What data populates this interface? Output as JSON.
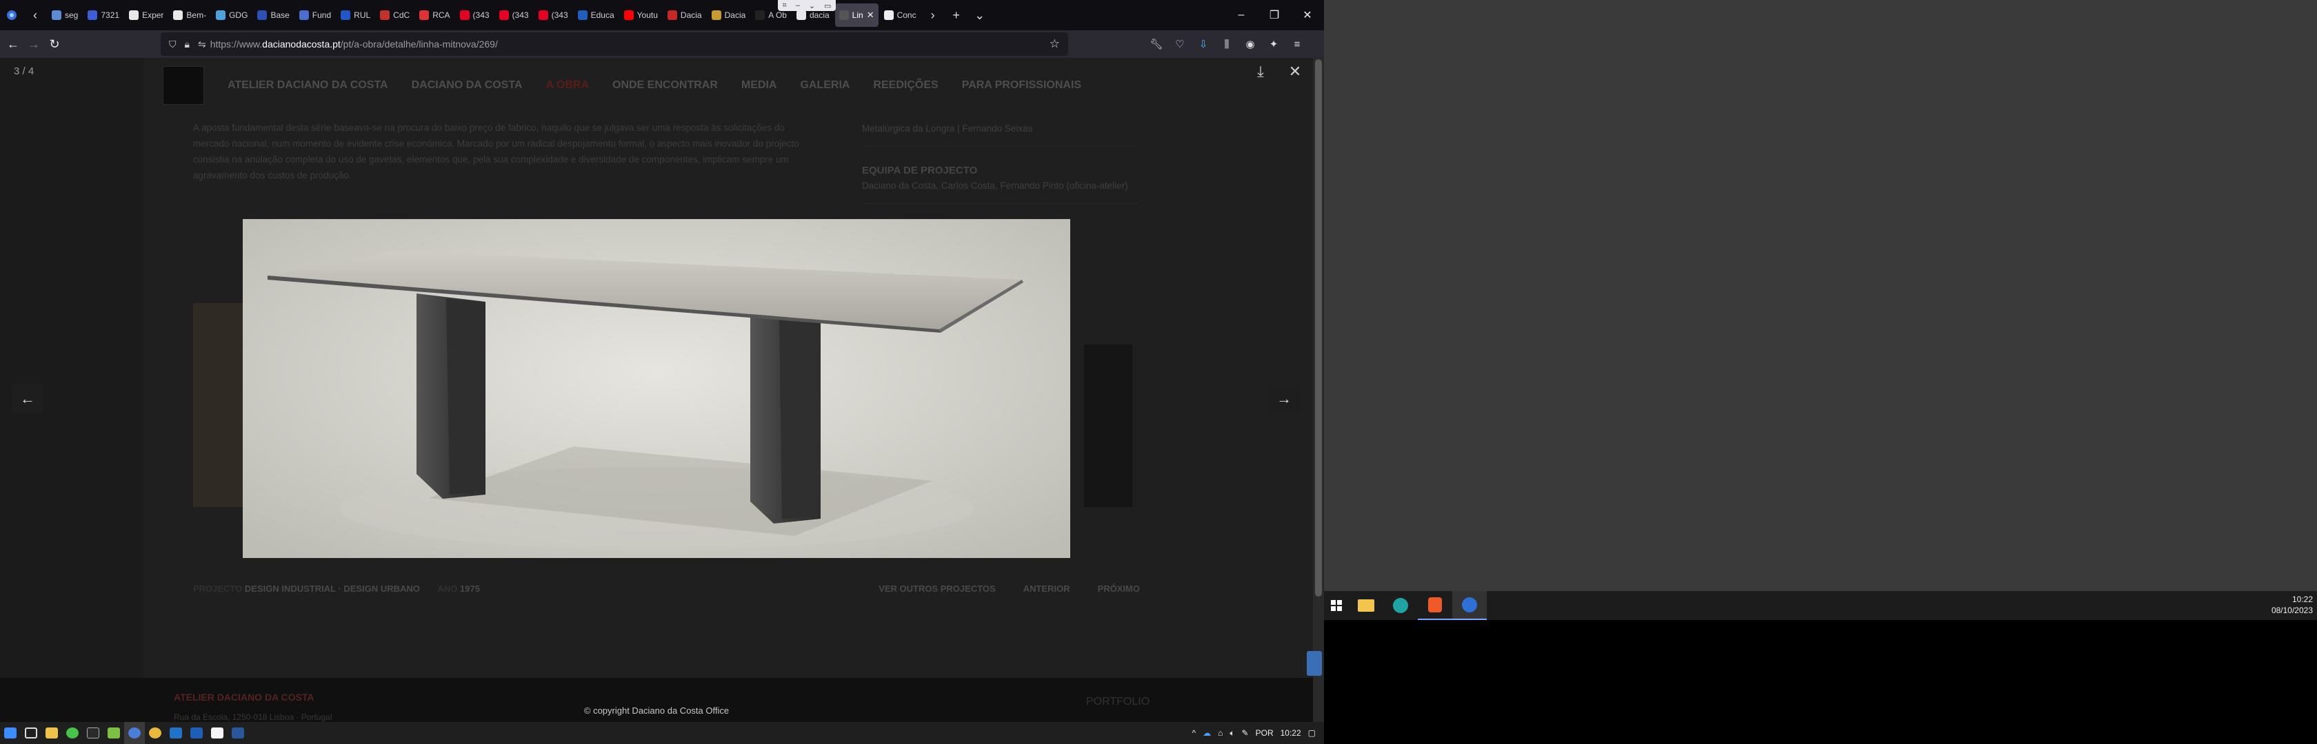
{
  "browser": {
    "tabs": [
      {
        "label": "seg",
        "color": "#5b8dd6"
      },
      {
        "label": "7321",
        "color": "#3a5fd9"
      },
      {
        "label": "Exper",
        "color": "#e8e8e8"
      },
      {
        "label": "Bem-",
        "color": "#e8e8e8"
      },
      {
        "label": "GDG",
        "color": "#4aa3df"
      },
      {
        "label": "Base",
        "color": "#2e4fb5"
      },
      {
        "label": "Fund",
        "color": "#4a6fd1"
      },
      {
        "label": "RUL",
        "color": "#2057c9"
      },
      {
        "label": "CdC",
        "color": "#c4302b"
      },
      {
        "label": "RCA",
        "color": "#d33"
      },
      {
        "label": "(343",
        "color": "#e60023"
      },
      {
        "label": "(343",
        "color": "#e60023"
      },
      {
        "label": "(343",
        "color": "#e60023"
      },
      {
        "label": "Educa",
        "color": "#1f5fbf"
      },
      {
        "label": "Youtu",
        "color": "#ff0000"
      },
      {
        "label": "Dacia",
        "color": "#c62828"
      },
      {
        "label": "Dacia",
        "color": "#c89b2e"
      },
      {
        "label": "A Ob",
        "color": "#222"
      },
      {
        "label": "dacia",
        "color": "#e8e8e8"
      },
      {
        "label": "Lin",
        "color": "#555",
        "active": true
      },
      {
        "label": "Conc",
        "color": "#eee"
      }
    ],
    "url_prefix": "https://www.",
    "url_domain": "dacianodacosta.pt",
    "url_path": "/pt/a-obra/detalhe/linha-mitnova/269/"
  },
  "site": {
    "nav": [
      "ATELIER DACIANO DA COSTA",
      "DACIANO DA COSTA",
      "A OBRA",
      "ONDE ENCONTRAR",
      "MEDIA",
      "GALERIA",
      "REEDIÇÕES",
      "PARA PROFISSIONAIS"
    ],
    "intro": "A aposta fundamental desta série baseava-se na procura do baixo preço de fabrico, naquilo que se julgava ser uma resposta às solicitações do mercado nacional, num momento de evidente crise económica. Marcado por um radical despojamento formal, o aspecto mais inovador do projecto consistia na anulação completa do uso de gavetas, elementos que, pela sua complexidade e diversidade de componentes, implicam sempre um agravamento dos custos de produção.",
    "right_col": {
      "manufacturer": "Metalúrgica da Longra | Fernando Seixas",
      "team_heading": "EQUIPA DE PROJECTO",
      "team": "Daciano da Costa, Carlos Costa, Fernando Pinto (oficina-atelier)"
    },
    "meta": {
      "label_projecto": "PROJECTO",
      "projecto": "DESIGN INDUSTRIAL · DESIGN URBANO",
      "label_ano": "ANO",
      "ano": "1975",
      "outros": "VER OUTROS PROJECTOS",
      "anterior": "ANTERIOR",
      "proximo": "PRÓXIMO"
    },
    "footer": {
      "brand": "ATELIER DACIANO DA COSTA",
      "address": "Rua da Escola, 1250-018 Lisboa · Portugal",
      "right": "PORTFOLIO"
    }
  },
  "lightbox": {
    "counter": "3 / 4",
    "caption": "© copyright Daciano da Costa Office"
  },
  "system": {
    "lang": "POR",
    "time": "10:22",
    "date": "08/10/2023"
  }
}
